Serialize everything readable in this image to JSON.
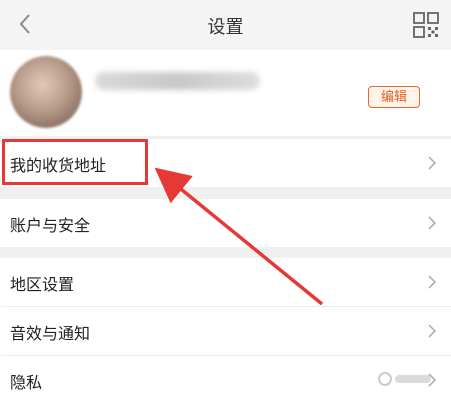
{
  "header": {
    "title": "设置",
    "back_icon": "chevron-left-icon",
    "qr_icon": "qr-grid-icon"
  },
  "profile": {
    "edit_label": "编辑"
  },
  "menu": [
    {
      "label": "我的收货地址"
    },
    {
      "label": "账户与安全"
    },
    {
      "label": "地区设置"
    },
    {
      "label": "音效与通知"
    },
    {
      "label": "隐私"
    }
  ],
  "annotation": {
    "box_color": "#e53935",
    "arrow_color": "#e53935"
  },
  "colors": {
    "accent": "#e0601f",
    "background": "#f0f0f0"
  }
}
